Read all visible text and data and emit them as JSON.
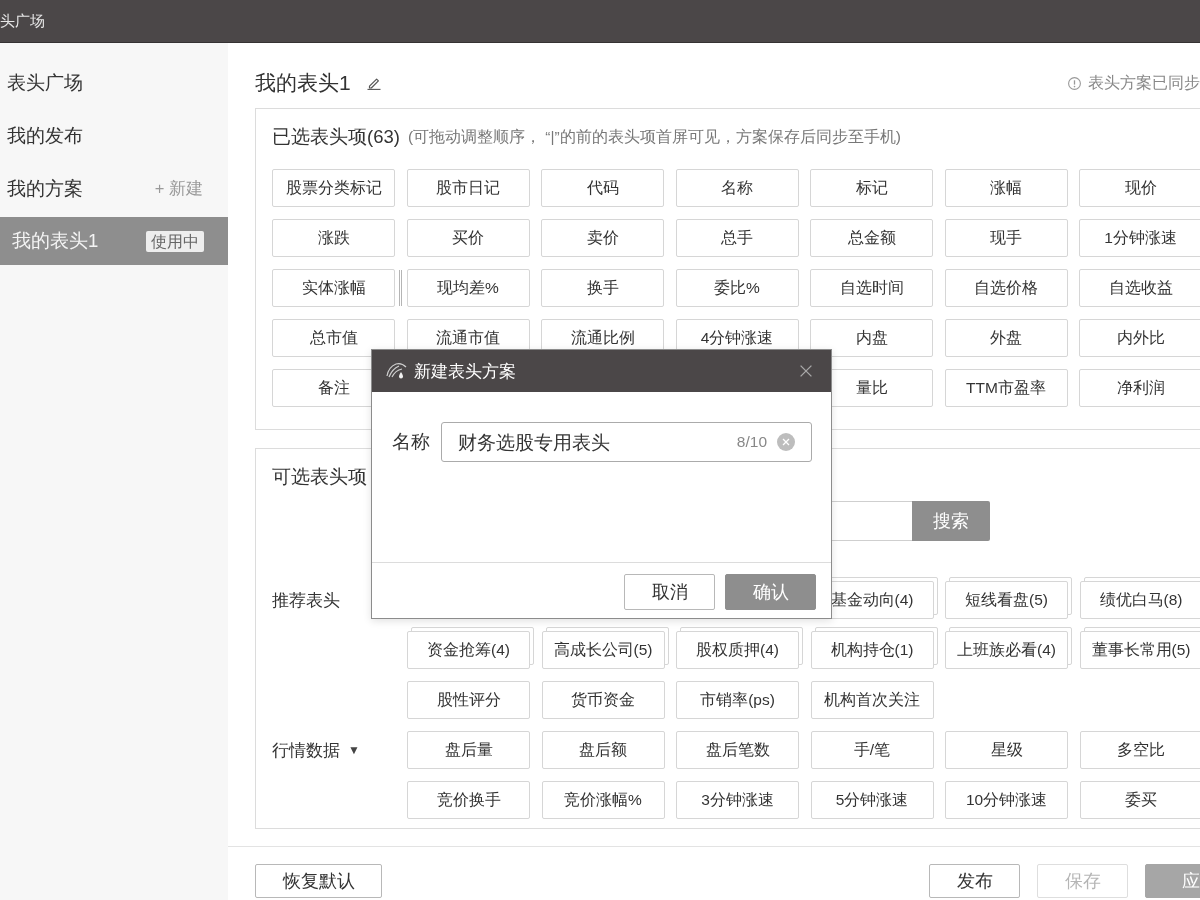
{
  "title_bar": {
    "title": "头广场"
  },
  "sidebar": {
    "items": [
      {
        "label": "表头广场",
        "selected": false
      },
      {
        "label": "我的发布",
        "selected": false
      },
      {
        "label": "我的方案",
        "selected": false,
        "action": "+ 新建",
        "children": [
          {
            "label": "我的表头1",
            "selected": true,
            "badge": "使用中"
          }
        ]
      }
    ]
  },
  "header": {
    "title": "我的表头1",
    "sync_note": "表头方案已同步"
  },
  "selected_panel": {
    "title": "已选表头项(63)",
    "hint": "(可拖动调整顺序， “|”的前的表头项首屏可见，方案保存后同步至手机)",
    "rows": [
      [
        {
          "kind": "chip",
          "label": "股票分类标记"
        },
        {
          "kind": "chip",
          "label": "股市日记"
        },
        {
          "kind": "chip",
          "label": "代码"
        },
        {
          "kind": "chip",
          "label": "名称"
        },
        {
          "kind": "chip",
          "label": "标记"
        },
        {
          "kind": "chip",
          "label": "涨幅"
        },
        {
          "kind": "chip",
          "label": "现价"
        }
      ],
      [
        {
          "kind": "chip",
          "label": "涨跌"
        },
        {
          "kind": "chip",
          "label": "买价"
        },
        {
          "kind": "chip",
          "label": "卖价"
        },
        {
          "kind": "chip",
          "label": "总手"
        },
        {
          "kind": "chip",
          "label": "总金额"
        },
        {
          "kind": "chip",
          "label": "现手"
        },
        {
          "kind": "chip",
          "label": "1分钟涨速"
        }
      ],
      [
        {
          "kind": "boundary",
          "label": "实体涨幅"
        },
        {
          "kind": "chip",
          "label": "现均差%"
        },
        {
          "kind": "chip",
          "label": "换手"
        },
        {
          "kind": "chip",
          "label": "委比%"
        },
        {
          "kind": "chip",
          "label": "自选时间"
        },
        {
          "kind": "chip",
          "label": "自选价格"
        },
        {
          "kind": "chip",
          "label": "自选收益"
        }
      ],
      [
        {
          "kind": "chip",
          "label": "总市值"
        },
        {
          "kind": "chip",
          "label": "流通市值"
        },
        {
          "kind": "chip",
          "label": "流通比例"
        },
        {
          "kind": "chip",
          "label": "4分钟涨速"
        },
        {
          "kind": "chip",
          "label": "内盘"
        },
        {
          "kind": "chip",
          "label": "外盘"
        },
        {
          "kind": "chip",
          "label": "内外比"
        }
      ],
      [
        {
          "kind": "chip",
          "label": "备注"
        },
        null,
        null,
        null,
        {
          "kind": "chip",
          "label": "量比"
        },
        {
          "kind": "chip",
          "label": "TTM市盈率"
        },
        {
          "kind": "chip",
          "label": "净利润"
        }
      ]
    ]
  },
  "available_panel": {
    "title": "可选表头项",
    "search_button": "搜索",
    "sections": [
      {
        "label": "推荐表头",
        "rows": [
          [
            null,
            null,
            null,
            {
              "kind": "group",
              "label": "基金动向(4)"
            },
            {
              "kind": "group",
              "label": "短线看盘(5)"
            },
            {
              "kind": "group",
              "label": "绩优白马(8)"
            }
          ],
          [
            {
              "kind": "group",
              "label": "资金抢筹(4)"
            },
            {
              "kind": "group",
              "label": "高成长公司(5)"
            },
            {
              "kind": "group",
              "label": "股权质押(4)"
            },
            {
              "kind": "group",
              "label": "机构持仓(1)"
            },
            {
              "kind": "group",
              "label": "上班族必看(4)"
            },
            {
              "kind": "group",
              "label": "董事长常用(5)"
            }
          ],
          [
            {
              "kind": "item",
              "label": "股性评分"
            },
            {
              "kind": "item",
              "label": "货币资金"
            },
            {
              "kind": "item",
              "label": "市销率(ps)"
            },
            {
              "kind": "item",
              "label": "机构首次关注"
            }
          ]
        ]
      },
      {
        "label": "行情数据",
        "caret": "▼",
        "rows": [
          [
            {
              "kind": "item",
              "label": "盘后量"
            },
            {
              "kind": "item",
              "label": "盘后额"
            },
            {
              "kind": "item",
              "label": "盘后笔数"
            },
            {
              "kind": "item",
              "label": "手/笔"
            },
            {
              "kind": "item",
              "label": "星级"
            },
            {
              "kind": "item",
              "label": "多空比"
            }
          ],
          [
            {
              "kind": "item",
              "label": "竞价换手"
            },
            {
              "kind": "item",
              "label": "竞价涨幅%"
            },
            {
              "kind": "item",
              "label": "3分钟涨速"
            },
            {
              "kind": "item",
              "label": "5分钟涨速"
            },
            {
              "kind": "item",
              "label": "10分钟涨速"
            },
            {
              "kind": "item",
              "label": "委买"
            }
          ]
        ]
      }
    ]
  },
  "modal": {
    "title": "新建表头方案",
    "field": {
      "label": "名称",
      "value": "财务选股专用表头",
      "counter": "8/10"
    },
    "buttons": [
      {
        "label": "取消",
        "kind": "default"
      },
      {
        "label": "确认",
        "kind": "primary"
      }
    ]
  },
  "footer": {
    "left_buttons": [
      {
        "label": "恢复默认",
        "kind": "default",
        "disabled": false
      }
    ],
    "right_buttons": [
      {
        "label": "发布",
        "kind": "default",
        "disabled": false
      },
      {
        "label": "保存",
        "kind": "default",
        "disabled": true
      },
      {
        "label": "应",
        "kind": "primary",
        "disabled": true
      }
    ]
  }
}
